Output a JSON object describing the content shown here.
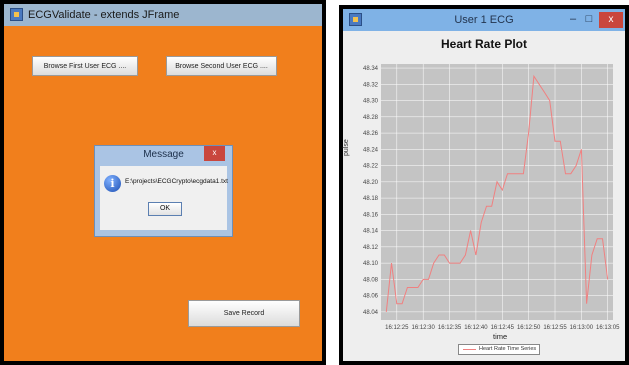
{
  "left_window": {
    "title": "ECGValidate - extends JFrame",
    "browse_first_label": "Browse First User ECG ....",
    "browse_second_label": "Browse Second User ECG ....",
    "save_record_label": "Save Record",
    "background_color": "#f17f1c",
    "icon": "java-frame-icon"
  },
  "dialog": {
    "title": "Message",
    "close_label": "x",
    "message": "E:\\projects\\ECGCrypto\\ecgdata1.txt",
    "ok_label": "OK",
    "icon": "info-icon"
  },
  "right_window": {
    "title": "User 1 ECG",
    "minimize_label": "–",
    "maximize_label": "□",
    "close_label": "x",
    "icon": "java-frame-icon"
  },
  "chart_data": {
    "type": "line",
    "title": "Heart Rate Plot",
    "xlabel": "time",
    "ylabel": "pulse",
    "x_tick_labels": [
      "16:12:25",
      "16:12:30",
      "16:12:35",
      "16:12:40",
      "16:12:45",
      "16:12:50",
      "16:12:55",
      "16:13:00",
      "16:13:05"
    ],
    "x_tick_values": [
      0,
      5,
      10,
      15,
      20,
      25,
      30,
      35,
      40
    ],
    "ylim": [
      48.03,
      48.345
    ],
    "y_ticks": [
      "48.04",
      "48.06",
      "48.08",
      "48.10",
      "48.12",
      "48.14",
      "48.16",
      "48.18",
      "48.20",
      "48.22",
      "48.24",
      "48.26",
      "48.28",
      "48.30",
      "48.32",
      "48.34"
    ],
    "y_tick_values": [
      48.04,
      48.06,
      48.08,
      48.1,
      48.12,
      48.14,
      48.16,
      48.18,
      48.2,
      48.22,
      48.24,
      48.26,
      48.28,
      48.3,
      48.32,
      48.34
    ],
    "x_range": [
      -3,
      41
    ],
    "grid": true,
    "legend_position": "bottom",
    "series": [
      {
        "name": "Heart Rate Time Series",
        "color": "#f08080",
        "x": [
          -2,
          -1,
          0,
          1,
          2,
          3,
          4,
          5,
          6,
          7,
          8,
          9,
          10,
          11,
          12,
          13,
          14,
          15,
          16,
          17,
          18,
          19,
          20,
          21,
          22,
          23,
          24,
          25,
          26,
          27,
          28,
          29,
          30,
          31,
          32,
          33,
          34,
          35,
          36,
          37,
          38,
          39,
          40
        ],
        "y": [
          48.04,
          48.1,
          48.05,
          48.05,
          48.07,
          48.07,
          48.07,
          48.08,
          48.08,
          48.1,
          48.11,
          48.11,
          48.1,
          48.1,
          48.1,
          48.11,
          48.14,
          48.11,
          48.15,
          48.17,
          48.17,
          48.2,
          48.19,
          48.21,
          48.21,
          48.21,
          48.21,
          48.26,
          48.33,
          48.32,
          48.31,
          48.3,
          48.25,
          48.25,
          48.21,
          48.21,
          48.22,
          48.24,
          48.05,
          48.11,
          48.13,
          48.13,
          48.08
        ]
      }
    ]
  }
}
